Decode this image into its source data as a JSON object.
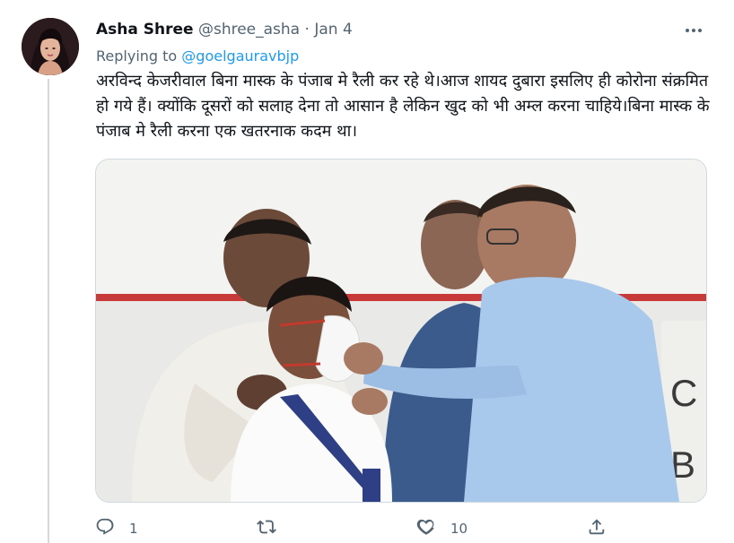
{
  "tweet": {
    "author_name": "Asha Shree",
    "author_handle": "@shree_asha",
    "separator": "·",
    "date": "Jan 4",
    "more_icon": "more-dots-icon",
    "reply_prefix": "Replying to",
    "reply_mention": "@goelgauravbjp",
    "text": "अरविन्द केजरीवाल बिना मास्क के पंजाब मे रैली कर रहे थे।आज शायद दुबारा इसलिए ही कोरोना संक्रमित हो गये हैं। क्योंकि दूसरों को सलाह देना तो आसान है लेकिन खुद को भी अम्ल करना चाहिये।बिना मास्क के पंजाब मे रैली करना एक खतरनाक कदम था।",
    "media_sign_letters": [
      "C",
      "B"
    ]
  },
  "actions": {
    "reply_icon": "reply-icon",
    "reply_count": "1",
    "retweet_icon": "retweet-icon",
    "retweet_count": "",
    "like_icon": "heart-icon",
    "like_count": "10",
    "share_icon": "share-icon"
  },
  "colors": {
    "accent": "#1d9bf0",
    "secondary_text": "#536471",
    "primary_text": "#0f1419",
    "divider": "#cfd9de"
  }
}
